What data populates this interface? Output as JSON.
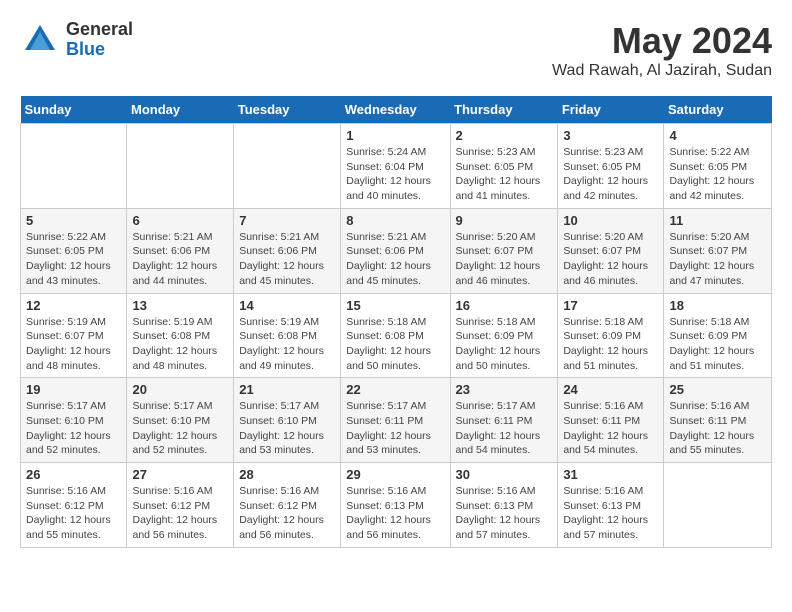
{
  "header": {
    "logo_general": "General",
    "logo_blue": "Blue",
    "month_title": "May 2024",
    "location": "Wad Rawah, Al Jazirah, Sudan"
  },
  "days_of_week": [
    "Sunday",
    "Monday",
    "Tuesday",
    "Wednesday",
    "Thursday",
    "Friday",
    "Saturday"
  ],
  "weeks": [
    [
      {
        "day": "",
        "info": ""
      },
      {
        "day": "",
        "info": ""
      },
      {
        "day": "",
        "info": ""
      },
      {
        "day": "1",
        "info": "Sunrise: 5:24 AM\nSunset: 6:04 PM\nDaylight: 12 hours\nand 40 minutes."
      },
      {
        "day": "2",
        "info": "Sunrise: 5:23 AM\nSunset: 6:05 PM\nDaylight: 12 hours\nand 41 minutes."
      },
      {
        "day": "3",
        "info": "Sunrise: 5:23 AM\nSunset: 6:05 PM\nDaylight: 12 hours\nand 42 minutes."
      },
      {
        "day": "4",
        "info": "Sunrise: 5:22 AM\nSunset: 6:05 PM\nDaylight: 12 hours\nand 42 minutes."
      }
    ],
    [
      {
        "day": "5",
        "info": "Sunrise: 5:22 AM\nSunset: 6:05 PM\nDaylight: 12 hours\nand 43 minutes."
      },
      {
        "day": "6",
        "info": "Sunrise: 5:21 AM\nSunset: 6:06 PM\nDaylight: 12 hours\nand 44 minutes."
      },
      {
        "day": "7",
        "info": "Sunrise: 5:21 AM\nSunset: 6:06 PM\nDaylight: 12 hours\nand 45 minutes."
      },
      {
        "day": "8",
        "info": "Sunrise: 5:21 AM\nSunset: 6:06 PM\nDaylight: 12 hours\nand 45 minutes."
      },
      {
        "day": "9",
        "info": "Sunrise: 5:20 AM\nSunset: 6:07 PM\nDaylight: 12 hours\nand 46 minutes."
      },
      {
        "day": "10",
        "info": "Sunrise: 5:20 AM\nSunset: 6:07 PM\nDaylight: 12 hours\nand 46 minutes."
      },
      {
        "day": "11",
        "info": "Sunrise: 5:20 AM\nSunset: 6:07 PM\nDaylight: 12 hours\nand 47 minutes."
      }
    ],
    [
      {
        "day": "12",
        "info": "Sunrise: 5:19 AM\nSunset: 6:07 PM\nDaylight: 12 hours\nand 48 minutes."
      },
      {
        "day": "13",
        "info": "Sunrise: 5:19 AM\nSunset: 6:08 PM\nDaylight: 12 hours\nand 48 minutes."
      },
      {
        "day": "14",
        "info": "Sunrise: 5:19 AM\nSunset: 6:08 PM\nDaylight: 12 hours\nand 49 minutes."
      },
      {
        "day": "15",
        "info": "Sunrise: 5:18 AM\nSunset: 6:08 PM\nDaylight: 12 hours\nand 50 minutes."
      },
      {
        "day": "16",
        "info": "Sunrise: 5:18 AM\nSunset: 6:09 PM\nDaylight: 12 hours\nand 50 minutes."
      },
      {
        "day": "17",
        "info": "Sunrise: 5:18 AM\nSunset: 6:09 PM\nDaylight: 12 hours\nand 51 minutes."
      },
      {
        "day": "18",
        "info": "Sunrise: 5:18 AM\nSunset: 6:09 PM\nDaylight: 12 hours\nand 51 minutes."
      }
    ],
    [
      {
        "day": "19",
        "info": "Sunrise: 5:17 AM\nSunset: 6:10 PM\nDaylight: 12 hours\nand 52 minutes."
      },
      {
        "day": "20",
        "info": "Sunrise: 5:17 AM\nSunset: 6:10 PM\nDaylight: 12 hours\nand 52 minutes."
      },
      {
        "day": "21",
        "info": "Sunrise: 5:17 AM\nSunset: 6:10 PM\nDaylight: 12 hours\nand 53 minutes."
      },
      {
        "day": "22",
        "info": "Sunrise: 5:17 AM\nSunset: 6:11 PM\nDaylight: 12 hours\nand 53 minutes."
      },
      {
        "day": "23",
        "info": "Sunrise: 5:17 AM\nSunset: 6:11 PM\nDaylight: 12 hours\nand 54 minutes."
      },
      {
        "day": "24",
        "info": "Sunrise: 5:16 AM\nSunset: 6:11 PM\nDaylight: 12 hours\nand 54 minutes."
      },
      {
        "day": "25",
        "info": "Sunrise: 5:16 AM\nSunset: 6:11 PM\nDaylight: 12 hours\nand 55 minutes."
      }
    ],
    [
      {
        "day": "26",
        "info": "Sunrise: 5:16 AM\nSunset: 6:12 PM\nDaylight: 12 hours\nand 55 minutes."
      },
      {
        "day": "27",
        "info": "Sunrise: 5:16 AM\nSunset: 6:12 PM\nDaylight: 12 hours\nand 56 minutes."
      },
      {
        "day": "28",
        "info": "Sunrise: 5:16 AM\nSunset: 6:12 PM\nDaylight: 12 hours\nand 56 minutes."
      },
      {
        "day": "29",
        "info": "Sunrise: 5:16 AM\nSunset: 6:13 PM\nDaylight: 12 hours\nand 56 minutes."
      },
      {
        "day": "30",
        "info": "Sunrise: 5:16 AM\nSunset: 6:13 PM\nDaylight: 12 hours\nand 57 minutes."
      },
      {
        "day": "31",
        "info": "Sunrise: 5:16 AM\nSunset: 6:13 PM\nDaylight: 12 hours\nand 57 minutes."
      },
      {
        "day": "",
        "info": ""
      }
    ]
  ]
}
